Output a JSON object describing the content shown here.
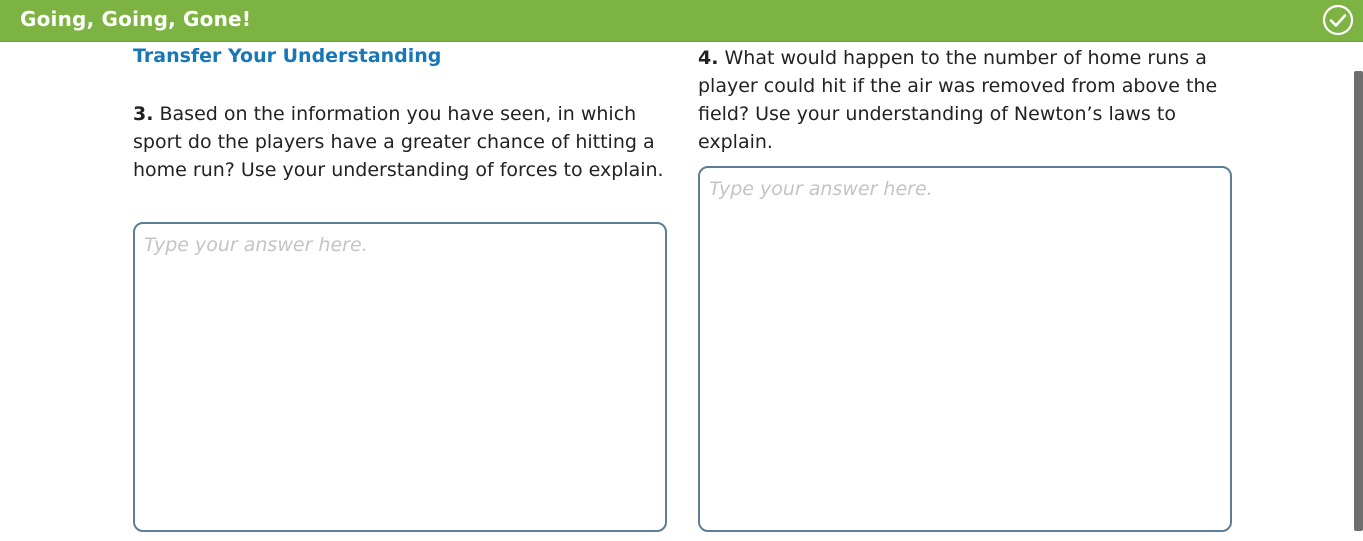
{
  "header": {
    "title": "Going, Going, Gone!",
    "check_icon": "check-circle-icon"
  },
  "section": {
    "heading": "Transfer Your Understanding"
  },
  "questions": [
    {
      "number": "3.",
      "text": " Based on the information you have seen, in which sport do the players have a greater chance of hitting a home run? Use your understanding of forces to explain.",
      "placeholder": "Type your answer here."
    },
    {
      "number": "4.",
      "text": " What would happen to the number of home runs a player could hit if the air was removed from above the field? Use your understanding of Newton’s laws to explain.",
      "placeholder": "Type your answer here."
    }
  ],
  "colors": {
    "header_bg": "#7cb342",
    "heading_blue": "#1777b8",
    "box_border": "#5c7e96"
  }
}
